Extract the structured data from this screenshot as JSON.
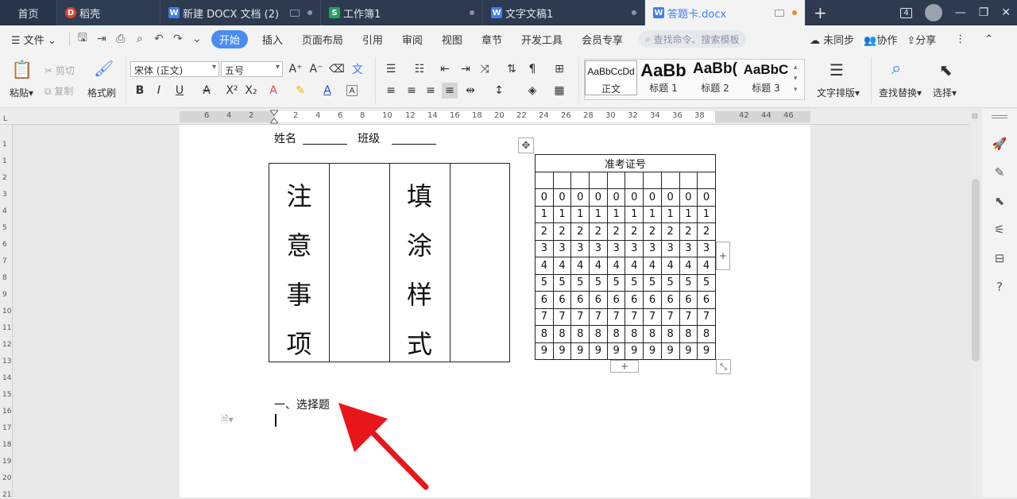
{
  "tabs": [
    {
      "label": "首页"
    },
    {
      "label": "稻壳"
    },
    {
      "label": "新建 DOCX 文档 (2)"
    },
    {
      "label": "工作簿1"
    },
    {
      "label": "文字文稿1"
    },
    {
      "label": "答题卡.docx"
    }
  ],
  "window": {
    "badge": "4"
  },
  "menu": {
    "file": "文件",
    "items": [
      "开始",
      "插入",
      "页面布局",
      "引用",
      "审阅",
      "视图",
      "章节",
      "开发工具",
      "会员专享"
    ],
    "search_placeholder": "查找命令、搜索模板",
    "sync": "未同步",
    "collab": "协作",
    "share": "分享"
  },
  "ribbon": {
    "paste": "粘贴",
    "cut": "剪切",
    "copy": "复制",
    "format_painter": "格式刷",
    "font": "宋体 (正文)",
    "size": "五号",
    "styles": [
      {
        "preview": "AaBbCcDd",
        "label": "正文"
      },
      {
        "preview": "AaBb",
        "label": "标题 1"
      },
      {
        "preview": "AaBb(",
        "label": "标题 2"
      },
      {
        "preview": "AaBbC",
        "label": "标题 3"
      }
    ],
    "text_layout": "文字排版",
    "find_replace": "查找替换",
    "select": "选择"
  },
  "ruler": {
    "h": [
      "6",
      "4",
      "2",
      "2",
      "4",
      "6",
      "8",
      "10",
      "12",
      "14",
      "16",
      "18",
      "20",
      "22",
      "24",
      "26",
      "28",
      "30",
      "32",
      "34",
      "36",
      "38",
      "42",
      "44",
      "46"
    ],
    "v": [
      "1",
      "1",
      "2",
      "3",
      "4",
      "5",
      "6",
      "7",
      "8",
      "9",
      "10",
      "11",
      "12",
      "13",
      "14",
      "15",
      "16",
      "17",
      "18",
      "19",
      "20",
      "21"
    ]
  },
  "doc": {
    "name_label": "姓名",
    "class_label": "班级",
    "notice": [
      "注",
      "意",
      "事",
      "项"
    ],
    "fill": [
      "填",
      "涂",
      "样",
      "式"
    ],
    "exam_title": "准考证号",
    "digits": [
      "0",
      "1",
      "2",
      "3",
      "4",
      "5",
      "6",
      "7",
      "8",
      "9"
    ],
    "section": "一、选择题"
  }
}
